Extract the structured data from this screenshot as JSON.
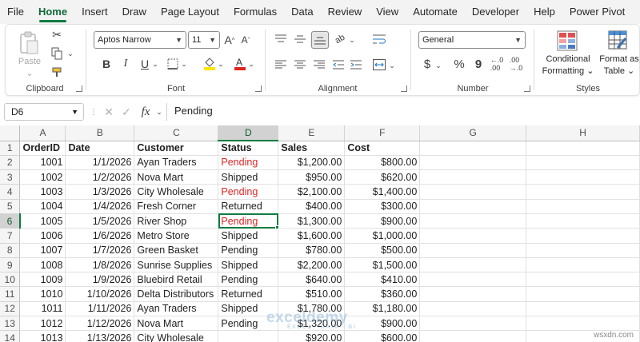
{
  "menu_tabs": [
    "File",
    "Home",
    "Insert",
    "Draw",
    "Page Layout",
    "Formulas",
    "Data",
    "Review",
    "View",
    "Automate",
    "Developer",
    "Help",
    "Power Pivot"
  ],
  "active_tab": "Home",
  "ribbon": {
    "clipboard": {
      "label": "Clipboard",
      "paste": "Paste"
    },
    "font": {
      "label": "Font",
      "font_name": "Aptos Narrow",
      "font_size": "11",
      "bold": "B",
      "italic": "I",
      "underline": "U"
    },
    "alignment": {
      "label": "Alignment"
    },
    "number": {
      "label": "Number",
      "format": "General",
      "currency": "$",
      "percent": "%",
      "comma": "9"
    },
    "styles": {
      "label": "Styles",
      "conditional": "Conditional",
      "formatting": "Formatting",
      "format_as": "Format as",
      "table": "Table"
    }
  },
  "formula_bar": {
    "name_box": "D6",
    "fx": "fx",
    "content": "Pending"
  },
  "columns": [
    "A",
    "B",
    "C",
    "D",
    "E",
    "F",
    "G",
    "H"
  ],
  "selected_column": "D",
  "selected_row": 6,
  "header_row": {
    "row": "1",
    "cells": [
      "OrderID",
      "Date",
      "Customer",
      "Status",
      "Sales",
      "Cost"
    ]
  },
  "rows": [
    {
      "row": "2",
      "id": "1001",
      "date": "1/1/2026",
      "customer": "Ayan Traders",
      "status": "Pending",
      "sales": "$1,200.00",
      "cost": "$800.00",
      "highlight": true
    },
    {
      "row": "3",
      "id": "1002",
      "date": "1/2/2026",
      "customer": "Nova Mart",
      "status": "Shipped",
      "sales": "$950.00",
      "cost": "$620.00",
      "highlight": false
    },
    {
      "row": "4",
      "id": "1003",
      "date": "1/3/2026",
      "customer": "City Wholesale",
      "status": "Pending",
      "sales": "$2,100.00",
      "cost": "$1,400.00",
      "highlight": true
    },
    {
      "row": "5",
      "id": "1004",
      "date": "1/4/2026",
      "customer": "Fresh Corner",
      "status": "Returned",
      "sales": "$400.00",
      "cost": "$300.00",
      "highlight": false
    },
    {
      "row": "6",
      "id": "1005",
      "date": "1/5/2026",
      "customer": "River Shop",
      "status": "Pending",
      "sales": "$1,300.00",
      "cost": "$900.00",
      "highlight": true
    },
    {
      "row": "7",
      "id": "1006",
      "date": "1/6/2026",
      "customer": "Metro Store",
      "status": "Shipped",
      "sales": "$1,600.00",
      "cost": "$1,000.00",
      "highlight": false
    },
    {
      "row": "8",
      "id": "1007",
      "date": "1/7/2026",
      "customer": "Green Basket",
      "status": "Pending",
      "sales": "$780.00",
      "cost": "$500.00",
      "highlight": false
    },
    {
      "row": "9",
      "id": "1008",
      "date": "1/8/2026",
      "customer": "Sunrise Supplies",
      "status": "Shipped",
      "sales": "$2,200.00",
      "cost": "$1,500.00",
      "highlight": false
    },
    {
      "row": "10",
      "id": "1009",
      "date": "1/9/2026",
      "customer": "Bluebird Retail",
      "status": "Pending",
      "sales": "$640.00",
      "cost": "$410.00",
      "highlight": false
    },
    {
      "row": "11",
      "id": "1010",
      "date": "1/10/2026",
      "customer": "Delta Distributors",
      "status": "Returned",
      "sales": "$510.00",
      "cost": "$360.00",
      "highlight": false
    },
    {
      "row": "12",
      "id": "1011",
      "date": "1/11/2026",
      "customer": "Ayan Traders",
      "status": "Shipped",
      "sales": "$1,780.00",
      "cost": "$1,180.00",
      "highlight": false
    },
    {
      "row": "13",
      "id": "1012",
      "date": "1/12/2026",
      "customer": "Nova Mart",
      "status": "Pending",
      "sales": "$1,320.00",
      "cost": "$900.00",
      "highlight": false
    },
    {
      "row": "14",
      "id": "1013",
      "date": "1/13/2026",
      "customer": "City Wholesale",
      "status": "",
      "sales": "$920.00",
      "cost": "$600.00",
      "highlight": false
    }
  ],
  "colors": {
    "accent": "#107c41",
    "highlight_text": "#e02424"
  },
  "watermark": {
    "brand": "exceldemy",
    "tagline": "EXCEL · DATA · BI",
    "site": "wsxdn.com"
  }
}
